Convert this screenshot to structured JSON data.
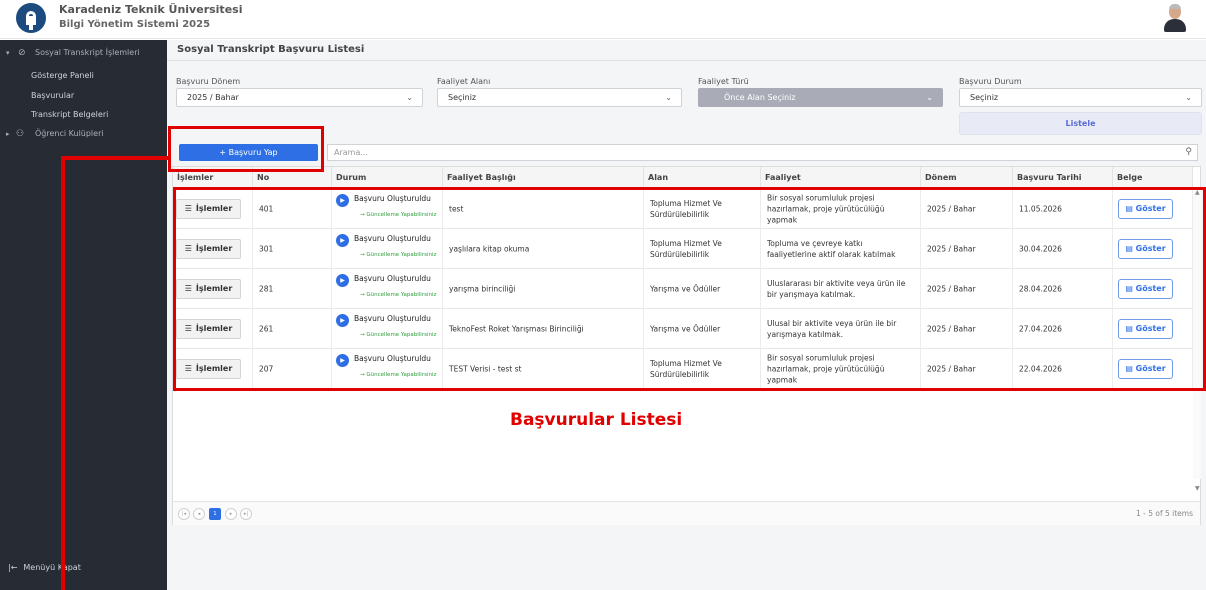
{
  "header": {
    "university": "Karadeniz Teknik Üniversitesi",
    "system": "Bilgi Yönetim Sistemi 2025",
    "logo_icon": "university-logo",
    "avatar_icon": "user-avatar"
  },
  "sidebar": {
    "main_item": "Sosyal Transkript İşlemleri",
    "items": [
      "Gösterge Paneli",
      "Başvurular",
      "Transkript Belgeleri"
    ],
    "clubs": "Öğrenci Kulüpleri",
    "menu_close": "Menüyü Kapat"
  },
  "page": {
    "title": "Sosyal Transkript Başvuru Listesi"
  },
  "filters": {
    "term_label": "Başvuru Dönem",
    "term_value": "2025 / Bahar",
    "area_label": "Faaliyet Alanı",
    "area_value": "Seçiniz",
    "type_label": "Faaliyet Türü",
    "type_value": "Önce Alan Seçiniz",
    "status_label": "Başvuru Durum",
    "status_value": "Seçiniz",
    "list_button": "Listele"
  },
  "toolbar": {
    "apply_button": "+ Başvuru Yap",
    "search_placeholder": "Arama..."
  },
  "table": {
    "columns": [
      "İşlemler",
      "No",
      "Durum",
      "Faaliyet Başlığı",
      "Alan",
      "Faaliyet",
      "Dönem",
      "Başvuru Tarihi",
      "Belge"
    ],
    "ops_label": "İşlemler",
    "show_label": "Göster",
    "rows": [
      {
        "no": "401",
        "status": "Başvuru Oluşturuldu",
        "status_sub": "→ Güncelleme Yapabilirsiniz",
        "title": "test",
        "area": "Topluma Hizmet Ve Sürdürülebilirlik",
        "activity": "Bir sosyal sorumluluk projesi hazırlamak, proje yürütücülüğü yapmak",
        "term": "2025 / Bahar",
        "date": "11.05.2026"
      },
      {
        "no": "301",
        "status": "Başvuru Oluşturuldu",
        "status_sub": "→ Güncelleme Yapabilirsiniz",
        "title": "yaşlılara kitap okuma",
        "area": "Topluma Hizmet Ve Sürdürülebilirlik",
        "activity": "Topluma ve çevreye katkı faaliyetlerine aktif olarak katılmak",
        "term": "2025 / Bahar",
        "date": "30.04.2026"
      },
      {
        "no": "281",
        "status": "Başvuru Oluşturuldu",
        "status_sub": "→ Güncelleme Yapabilirsiniz",
        "title": "yarışma birinciliği",
        "area": "Yarışma ve Ödüller",
        "activity": "Uluslararası bir aktivite veya ürün ile bir yarışmaya katılmak.",
        "term": "2025 / Bahar",
        "date": "28.04.2026"
      },
      {
        "no": "261",
        "status": "Başvuru Oluşturuldu",
        "status_sub": "→ Güncelleme Yapabilirsiniz",
        "title": "TeknoFest Roket Yarışması Birinciliği",
        "area": "Yarışma ve Ödüller",
        "activity": "Ulusal bir aktivite veya ürün ile bir yarışmaya katılmak.",
        "term": "2025 / Bahar",
        "date": "27.04.2026"
      },
      {
        "no": "207",
        "status": "Başvuru Oluşturuldu",
        "status_sub": "→ Güncelleme Yapabilirsiniz",
        "title": "TEST Verisi - test st",
        "area": "Topluma Hizmet Ve Sürdürülebilirlik",
        "activity": "Bir sosyal sorumluluk projesi hazırlamak, proje yürütücülüğü yapmak",
        "term": "2025 / Bahar",
        "date": "22.04.2026"
      }
    ]
  },
  "pager": {
    "current_page": "1",
    "info": "1 - 5 of 5 items"
  },
  "annotation": {
    "label": "Başvurular Listesi",
    "color": "#e00000"
  }
}
